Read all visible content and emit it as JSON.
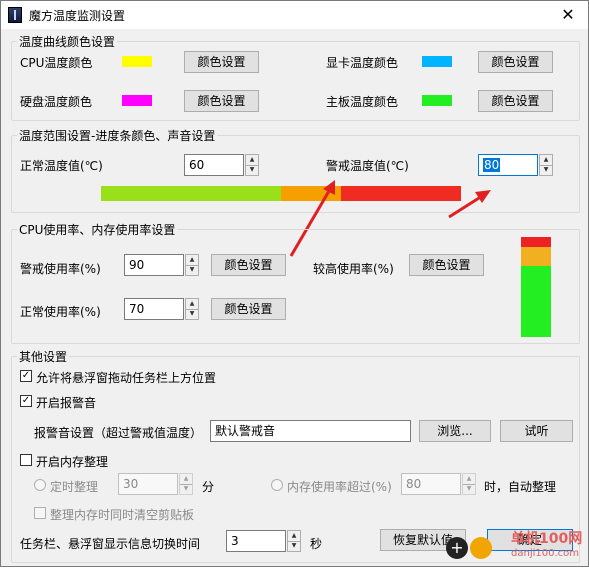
{
  "window": {
    "title": "魔方温度监测设置",
    "close_glyph": "✕"
  },
  "curve_colors": {
    "title": "温度曲线颜色设置",
    "cpu_label": "CPU温度颜色",
    "gpu_label": "显卡温度颜色",
    "disk_label": "硬盘温度颜色",
    "board_label": "主板温度颜色",
    "button_label": "颜色设置",
    "colors": {
      "cpu": "#ffff00",
      "gpu": "#00b4ff",
      "disk": "#ff00ff",
      "board": "#22ee22"
    }
  },
  "temp_range": {
    "title": "温度范围设置-进度条颜色、声音设置",
    "normal_label": "正常温度值(℃)",
    "normal_value": "60",
    "warn_label": "警戒温度值(℃)",
    "warn_value": "80",
    "bar_colors": {
      "normal": "#99e01a",
      "mid": "#f5a000",
      "high": "#f02b22"
    }
  },
  "usage": {
    "title": "CPU使用率、内存使用率设置",
    "warn_label": "警戒使用率(%)",
    "warn_value": "90",
    "high_label": "较高使用率(%)",
    "normal_label": "正常使用率(%)",
    "normal_value": "70",
    "button_label": "颜色设置",
    "bar_colors": {
      "top": "#ee2222",
      "mid": "#f0b020",
      "bottom": "#22ee22"
    }
  },
  "other": {
    "title": "其他设置",
    "allow_drag_label": "允许将悬浮窗拖动任务栏上方位置",
    "alarm_label": "开启报警音",
    "alarm_sound_label": "报警音设置（超过警戒值温度）",
    "alarm_sound_value": "默认警戒音",
    "browse_label": "浏览...",
    "test_label": "试听",
    "mem_clean_label": "开启内存整理",
    "timed_label": "定时整理",
    "timed_value": "30",
    "minute_unit": "分",
    "mem_over_label": "内存使用率超过(%)",
    "mem_over_value": "80",
    "auto_clean_label": "时，自动整理",
    "clear_clipboard_label": "整理内存时同时清空剪贴板",
    "switch_time_label": "任务栏、悬浮窗显示信息切换时间",
    "switch_time_value": "3",
    "second_unit": "秒",
    "restore_label": "恢复默认值",
    "ok_label": "确定",
    "check_glyph": "✓"
  },
  "watermark": {
    "text": "单机100网",
    "url": "danji100.com"
  }
}
